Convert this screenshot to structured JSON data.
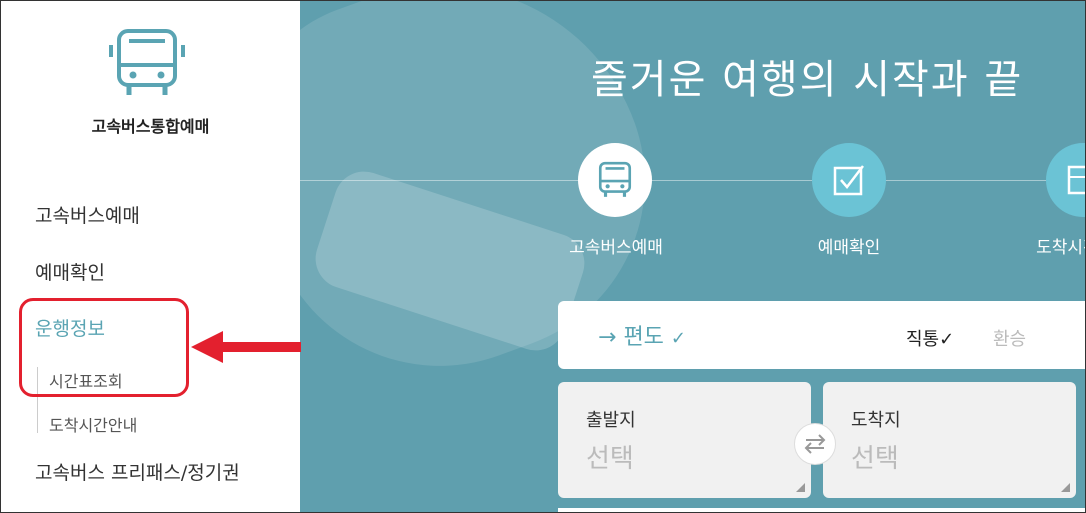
{
  "sidebar": {
    "brand": "고속버스통합예매",
    "logo_icon": "bus-icon",
    "menu": [
      {
        "label": "고속버스예매"
      },
      {
        "label": "예매확인"
      },
      {
        "label": "운행정보",
        "active": true
      },
      {
        "label": "고속버스 프리패스/정기권"
      }
    ],
    "submenu": [
      {
        "label": "시간표조회"
      },
      {
        "label": "도착시간안내"
      }
    ]
  },
  "main": {
    "hero_title": "즐거운 여행의 시작과 끝",
    "quick_menu": [
      {
        "label": "고속버스예매",
        "icon": "bus-icon"
      },
      {
        "label": "예매확인",
        "icon": "checkbox-icon"
      },
      {
        "label": "도착시간안내",
        "icon": "board-icon"
      }
    ],
    "trip": {
      "direction_arrow": "→",
      "direction_label": "편도",
      "direction_check": "✓",
      "direct_label": "직통",
      "direct_check": "✓",
      "transfer_label": "환승"
    },
    "departure": {
      "label": "출발지",
      "value": "선택"
    },
    "arrival": {
      "label": "도착지",
      "value": "선택"
    },
    "swap_icon": "swap-icon"
  },
  "colors": {
    "accent": "#5aa4b3",
    "highlight": "#e3202e",
    "main_bg": "#5f9fae",
    "circle_blue": "#6bc3d5"
  }
}
